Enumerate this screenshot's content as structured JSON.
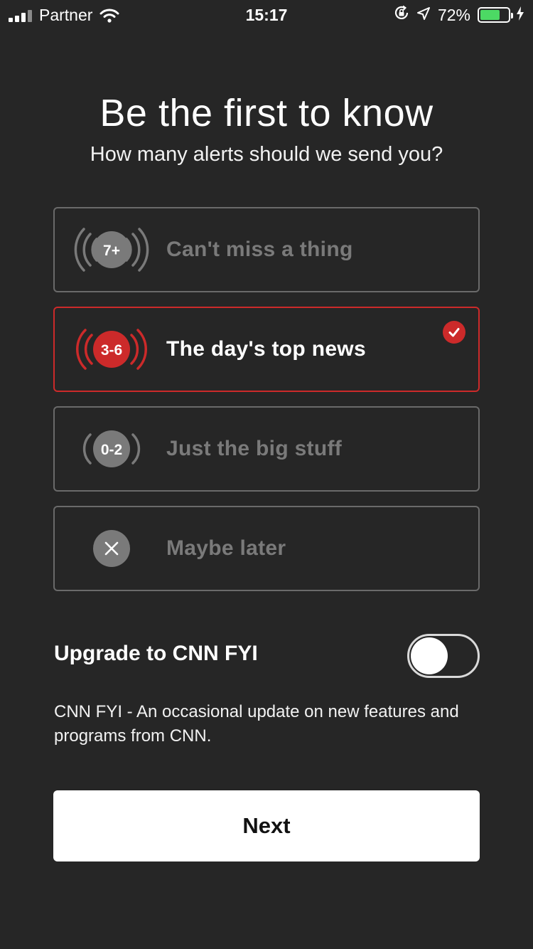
{
  "status_bar": {
    "carrier": "Partner",
    "time": "15:17",
    "battery_percent": "72%",
    "battery_level": 0.72,
    "icons": [
      "signal-icon",
      "wifi-icon",
      "orientation-lock-icon",
      "location-icon",
      "battery-icon",
      "charging-icon"
    ]
  },
  "header": {
    "title": "Be the first to know",
    "subtitle": "How many alerts should we send you?"
  },
  "options": [
    {
      "badge": "7+",
      "label": "Can't miss a thing",
      "selected": false
    },
    {
      "badge": "3-6",
      "label": "The day's top news",
      "selected": true
    },
    {
      "badge": "0-2",
      "label": "Just the big stuff",
      "selected": false
    },
    {
      "badge": "×",
      "label": "Maybe later",
      "selected": false
    }
  ],
  "upgrade": {
    "label": "Upgrade to CNN FYI",
    "enabled": false,
    "description": "CNN FYI - An occasional update on new features and programs from CNN."
  },
  "next_button": {
    "label": "Next"
  },
  "colors": {
    "background": "#262626",
    "accent": "#cc2a2a",
    "inactive": "#6a6a6a",
    "battery": "#4cd964"
  }
}
